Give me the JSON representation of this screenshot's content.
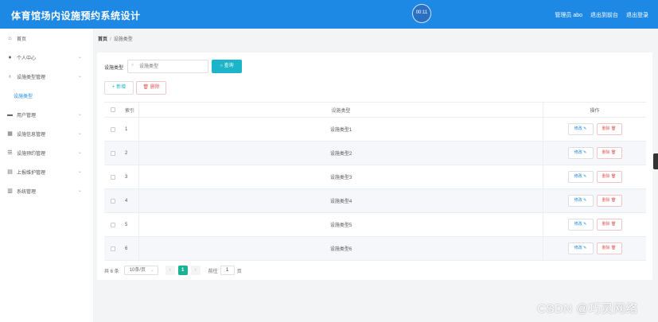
{
  "app": {
    "title": "体育馆场内设施预约系统设计",
    "clock": "00:11"
  },
  "top_links": [
    "管理员 abo",
    "退出到前台",
    "退出登录"
  ],
  "sidebar": {
    "items": [
      {
        "label": "首页",
        "icon": "home-icon",
        "glyph": "⌂",
        "chevron": false
      },
      {
        "label": "个人中心",
        "icon": "user-icon",
        "glyph": "●",
        "chevron": true
      },
      {
        "label": "设施类型管理",
        "icon": "mic-icon",
        "glyph": "♁",
        "chevron": true
      },
      {
        "label": "设施类型",
        "icon": "",
        "glyph": "",
        "chevron": false,
        "sub": true
      },
      {
        "label": "用户管理",
        "icon": "folder-icon",
        "glyph": "▬",
        "chevron": true
      },
      {
        "label": "设施信息管理",
        "icon": "building-icon",
        "glyph": "▦",
        "chevron": true
      },
      {
        "label": "设施预约管理",
        "icon": "list-icon",
        "glyph": "☰",
        "chevron": true
      },
      {
        "label": "上报维护管理",
        "icon": "report-icon",
        "glyph": "▤",
        "chevron": true
      },
      {
        "label": "系统管理",
        "icon": "settings-icon",
        "glyph": "▥",
        "chevron": true
      }
    ]
  },
  "breadcrumb": {
    "home": "首页",
    "current": "设施类型"
  },
  "search": {
    "label": "设施类型",
    "placeholder": "设施类型",
    "button": "查询"
  },
  "actions": {
    "add": "+ 新增",
    "delete": "删除"
  },
  "table": {
    "headers": {
      "index": "索引",
      "type": "设施类型",
      "ops": "操作"
    },
    "edit_label": "修改 ✎",
    "delete_label": "删除 🗑",
    "rows": [
      {
        "index": "1",
        "type": "设施类型1"
      },
      {
        "index": "2",
        "type": "设施类型2"
      },
      {
        "index": "3",
        "type": "设施类型3"
      },
      {
        "index": "4",
        "type": "设施类型4"
      },
      {
        "index": "5",
        "type": "设施类型5"
      },
      {
        "index": "6",
        "type": "设施类型6"
      }
    ]
  },
  "pagination": {
    "total": "共 6 条",
    "page_size": "10条/页",
    "prev": "‹",
    "current": "1",
    "next": "›",
    "goto_prefix": "前往",
    "goto_value": "1",
    "goto_suffix": "页"
  },
  "watermark": "CSDN @巧灵网络",
  "colors": {
    "header": "#1e88e5",
    "accent": "#1cb4c8",
    "danger": "#e05a5a",
    "page_active": "#19b394"
  }
}
